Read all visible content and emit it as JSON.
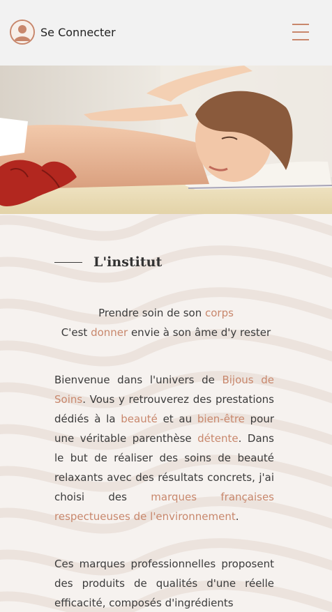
{
  "header": {
    "login_label": "Se Connecter",
    "user_icon": "user-circle-icon",
    "menu_icon": "hamburger-menu-icon"
  },
  "hero": {
    "image_alt": "massage photo"
  },
  "section": {
    "title": "L'institut"
  },
  "tagline": {
    "line1_pre": "Prendre soin de son ",
    "line1_accent": "corps",
    "line2_pre": "C'est ",
    "line2_accent": "donner",
    "line2_post": " envie à son âme d'y rester"
  },
  "intro": {
    "t1": "Bienvenue dans l'univers de ",
    "a1": "Bijous de Soins",
    "t2": ". Vous y retrouverez des prestations dédiés à la ",
    "a2": "beauté",
    "t3": " et au ",
    "a3": "bien-être",
    "t4": " pour une véritable parenthèse ",
    "a4": "détente",
    "t5": ". Dans le but de réaliser des soins de beauté relaxants avec des résultats concrets, j'ai choisi des ",
    "a5": "marques françaises respectueuses de l'environnement",
    "t6": "."
  },
  "second": {
    "text": "Ces marques professionnelles proposent des produits de qualités d'une réelle efficacité, composés d'ingrédients"
  },
  "colors": {
    "accent": "#c8876c",
    "topbar": "#f2f2f2",
    "text": "#3a3a3a"
  }
}
